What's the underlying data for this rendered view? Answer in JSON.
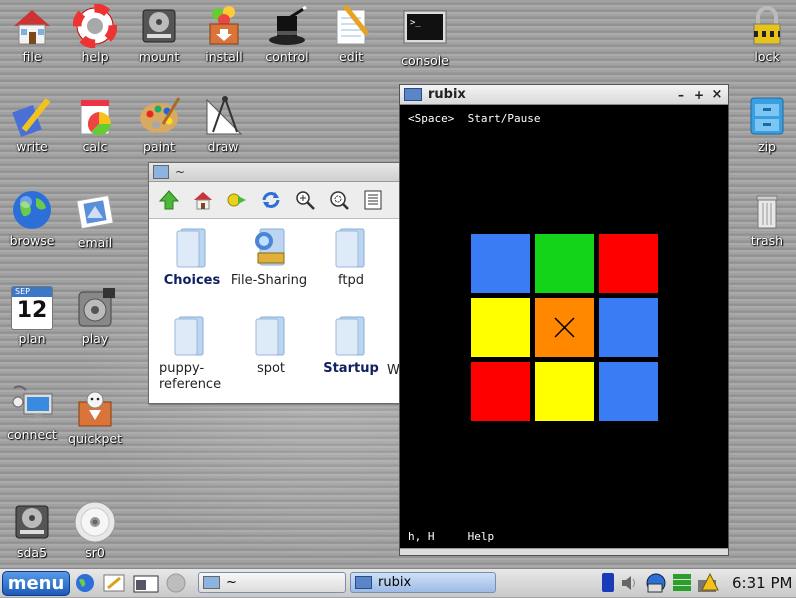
{
  "desktop": {
    "icons": [
      "file",
      "help",
      "mount",
      "install",
      "control",
      "edit",
      "console",
      "lock",
      "write",
      "calc",
      "paint",
      "draw",
      "zip",
      "browse",
      "email",
      "trash",
      "plan",
      "play",
      "connect",
      "quickpet",
      "sda5",
      "sr0"
    ],
    "calendar": {
      "month": "SEP",
      "day": "12"
    }
  },
  "filemanager": {
    "title": "~",
    "items": [
      "Choices",
      "File-Sharing",
      "ftpd",
      "puppy-\nreference",
      "spot",
      "Startup",
      "W"
    ]
  },
  "rubix": {
    "title": "rubix",
    "hint_top_key": "<Space>",
    "hint_top_action": "Start/Pause",
    "hint_bottom_key": "h, H",
    "hint_bottom_action": "Help",
    "grid_colors": [
      "#3a7cf3",
      "#13d419",
      "#ff0000",
      "#ffff00",
      "#ff8800",
      "#3a7cf3",
      "#ff0000",
      "#ffff00",
      "#3a7cf3"
    ],
    "window_buttons": [
      "–",
      "+",
      "×"
    ]
  },
  "taskbar": {
    "menu_label": "menu",
    "task_fm": "~",
    "task_rubix": "rubix",
    "clock": "6:31 PM"
  }
}
